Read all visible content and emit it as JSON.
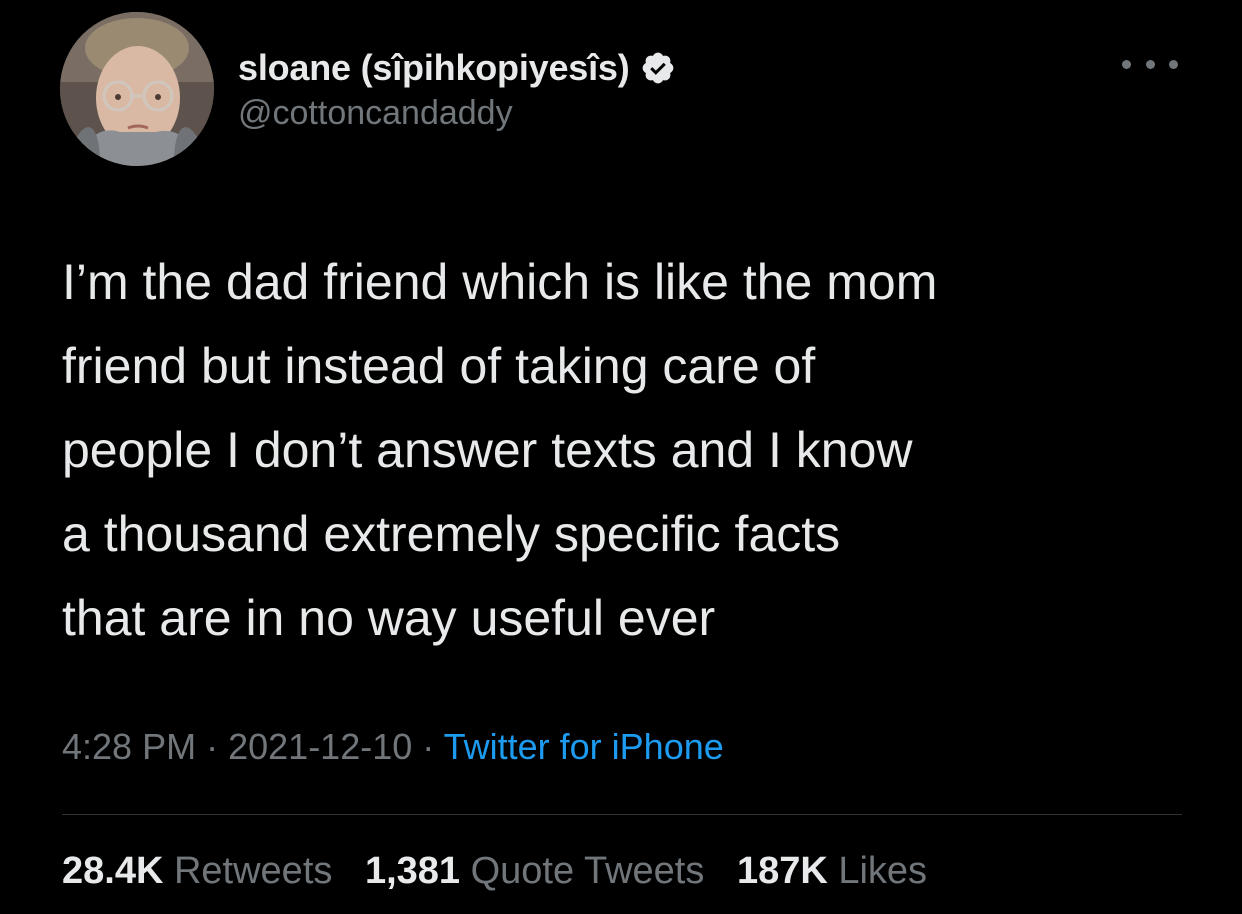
{
  "author": {
    "display_name": "sloane (sîpihkopiyesîs)",
    "handle": "@cottoncandaddy",
    "verified": true
  },
  "tweet": {
    "lines": [
      "I’m the dad friend which is like the mom",
      "friend but instead of taking care of",
      "people I don’t answer texts and I know",
      "a thousand extremely specific facts",
      "that are in no way useful ever"
    ],
    "time": "4:28 PM",
    "separator": "·",
    "date": "2021-12-10",
    "source": "Twitter for iPhone"
  },
  "stats": {
    "retweets_count": "28.4K",
    "retweets_label": "Retweets",
    "quotes_count": "1,381",
    "quotes_label": "Quote Tweets",
    "likes_count": "187K",
    "likes_label": "Likes"
  },
  "colors": {
    "background": "#000000",
    "text": "#e7e9ea",
    "secondary": "#71767b",
    "link": "#1d9bf0",
    "divider": "#2f3336"
  },
  "icons": {
    "verified": "verified-badge-icon",
    "more": "more-options-icon"
  }
}
